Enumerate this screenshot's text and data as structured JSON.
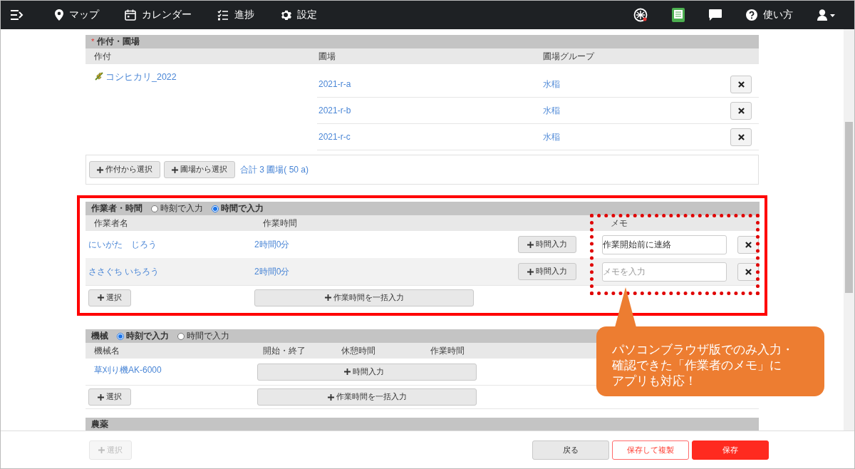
{
  "nav": {
    "items": [
      {
        "label": "マップ"
      },
      {
        "label": "カレンダー"
      },
      {
        "label": "進捗"
      },
      {
        "label": "設定"
      }
    ],
    "help": "使い方"
  },
  "crops_fields": {
    "required_mark": "*",
    "title": "作付・圃場",
    "columns": [
      "作付",
      "圃場",
      "圃場グループ"
    ],
    "crop": "コシヒカリ_2022",
    "fields": [
      {
        "name": "2021-r-a",
        "group": "水稲"
      },
      {
        "name": "2021-r-b",
        "group": "水稲"
      },
      {
        "name": "2021-r-c",
        "group": "水稲"
      }
    ],
    "buttons": [
      "作付から選択",
      "圃場から選択"
    ],
    "total": "合計 3 圃場( 50 a)"
  },
  "workers": {
    "title": "作業者・時間",
    "modes": [
      {
        "label": "時刻で入力",
        "selected": false
      },
      {
        "label": "時間で入力",
        "selected": true
      }
    ],
    "columns": [
      "作業者名",
      "作業時間",
      "メモ"
    ],
    "rows": [
      {
        "name": "にいがた　じろう",
        "duration": "2時間0分",
        "button": "時間入力",
        "memo": {
          "value": "作業開始前に連絡"
        }
      },
      {
        "name": "ささぐち いちろう",
        "duration": "2時間0分",
        "button": "時間入力",
        "memo": {
          "placeholder": "メモを入力"
        }
      }
    ],
    "select_button": "選択",
    "bulk_button": "作業時間を一括入力"
  },
  "machines": {
    "title": "機械",
    "modes": [
      {
        "label": "時刻で入力",
        "selected": true
      },
      {
        "label": "時間で入力",
        "selected": false
      }
    ],
    "columns": [
      "機械名",
      "開始・終了",
      "休憩時間",
      "作業時間"
    ],
    "rows": [
      {
        "name": "草刈り機AK-6000",
        "button": "時間入力"
      }
    ],
    "select_button": "選択",
    "bulk_button": "作業時間を一括入力"
  },
  "pesticide": {
    "title": "農薬"
  },
  "footer": {
    "select_button": {
      "label": "選択",
      "disabled": true
    },
    "back": "戻る",
    "save_copy": "保存して複製",
    "save": "保存"
  },
  "callout": {
    "lines": [
      "パソコンブラウザ版でのみ入力・",
      "確認できた「作業者のメモ」に",
      "アプリも対応！"
    ]
  }
}
